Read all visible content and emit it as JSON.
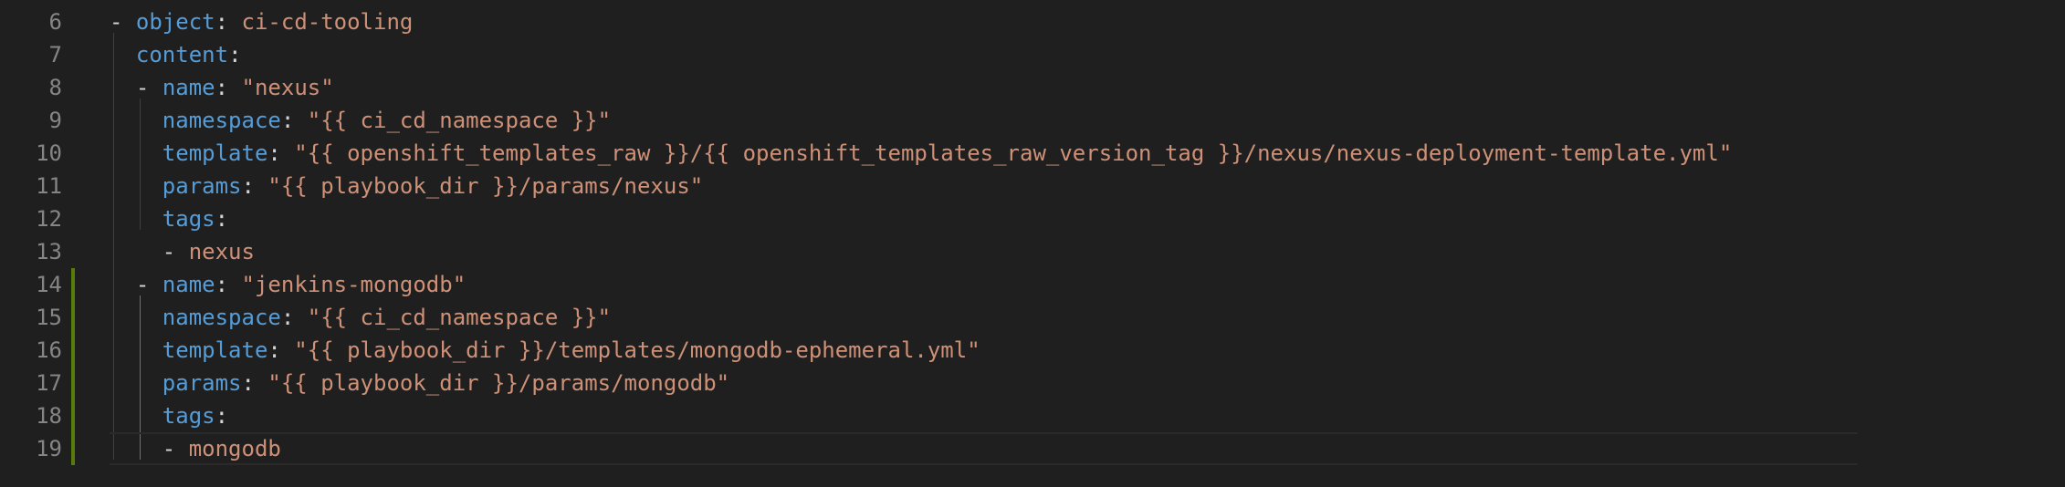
{
  "editor": {
    "lines": [
      {
        "number": "6",
        "indent": "",
        "dash": "- ",
        "key": "object",
        "value": "ci-cd-tooling"
      },
      {
        "number": "7",
        "indent": "  ",
        "dash": "",
        "key": "content",
        "value": ""
      },
      {
        "number": "8",
        "indent": "  ",
        "dash": "- ",
        "key": "name",
        "value": "\"nexus\""
      },
      {
        "number": "9",
        "indent": "    ",
        "dash": "",
        "key": "namespace",
        "value": "\"{{ ci_cd_namespace }}\""
      },
      {
        "number": "10",
        "indent": "    ",
        "dash": "",
        "key": "template",
        "value": "\"{{ openshift_templates_raw }}/{{ openshift_templates_raw_version_tag }}/nexus/nexus-deployment-template.yml\""
      },
      {
        "number": "11",
        "indent": "    ",
        "dash": "",
        "key": "params",
        "value": "\"{{ playbook_dir }}/params/nexus\""
      },
      {
        "number": "12",
        "indent": "    ",
        "dash": "",
        "key": "tags",
        "value": ""
      },
      {
        "number": "13",
        "indent": "    ",
        "dash": "- ",
        "key": "",
        "value": "nexus"
      },
      {
        "number": "14",
        "indent": "  ",
        "dash": "- ",
        "key": "name",
        "value": "\"jenkins-mongodb\""
      },
      {
        "number": "15",
        "indent": "    ",
        "dash": "",
        "key": "namespace",
        "value": "\"{{ ci_cd_namespace }}\""
      },
      {
        "number": "16",
        "indent": "    ",
        "dash": "",
        "key": "template",
        "value": "\"{{ playbook_dir }}/templates/mongodb-ephemeral.yml\""
      },
      {
        "number": "17",
        "indent": "    ",
        "dash": "",
        "key": "params",
        "value": "\"{{ playbook_dir }}/params/mongodb\""
      },
      {
        "number": "18",
        "indent": "    ",
        "dash": "",
        "key": "tags",
        "value": ""
      },
      {
        "number": "19",
        "indent": "    ",
        "dash": "- ",
        "key": "",
        "value": "mongodb"
      }
    ]
  },
  "colors": {
    "background": "#1f1f1f",
    "line_number": "#858585",
    "yaml_key": "#569cd6",
    "yaml_string": "#ce9178",
    "git_added": "#587c0c"
  }
}
